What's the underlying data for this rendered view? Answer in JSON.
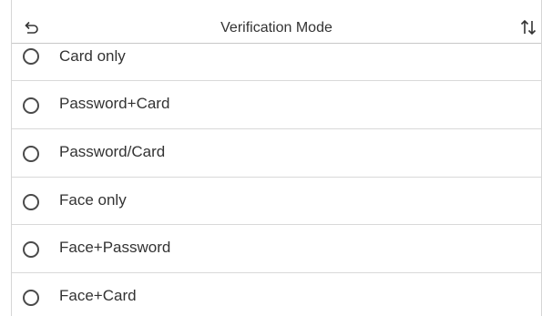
{
  "header": {
    "title": "Verification Mode"
  },
  "options": [
    {
      "label": "Card only",
      "selected": false
    },
    {
      "label": "Password+Card",
      "selected": false
    },
    {
      "label": "Password/Card",
      "selected": false
    },
    {
      "label": "Face only",
      "selected": false
    },
    {
      "label": "Face+Password",
      "selected": false
    },
    {
      "label": "Face+Card",
      "selected": false
    }
  ],
  "colors": {
    "text": "#333333",
    "divider": "#d9d9d9",
    "radio_border": "#4a4a4a"
  }
}
